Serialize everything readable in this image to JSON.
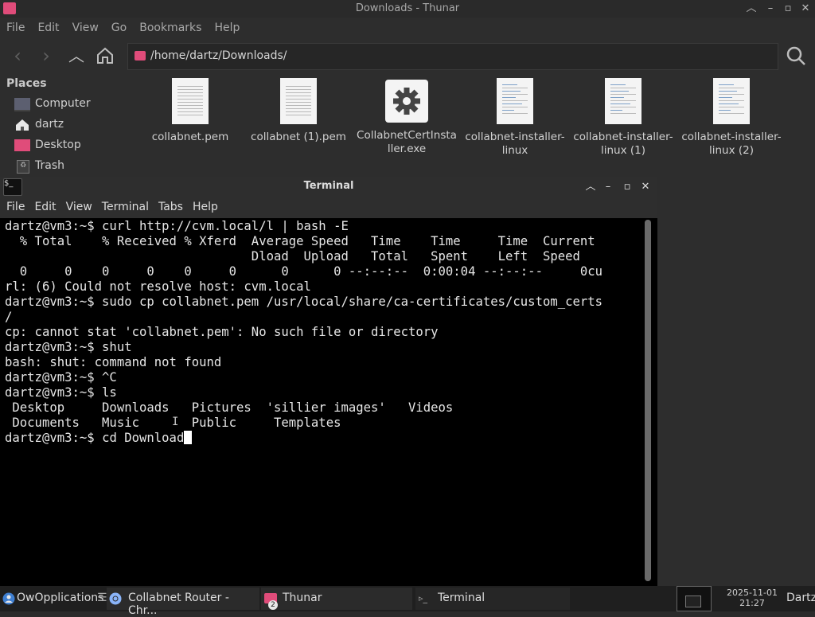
{
  "thunar": {
    "title": "Downloads - Thunar",
    "menu": [
      "File",
      "Edit",
      "View",
      "Go",
      "Bookmarks",
      "Help"
    ],
    "path": "/home/dartz/Downloads/",
    "places_header": "Places",
    "places": [
      "Computer",
      "dartz",
      "Desktop",
      "Trash"
    ],
    "files": [
      {
        "name": "collabnet.pem",
        "icon": "text-document-icon"
      },
      {
        "name": "collabnet (1).pem",
        "icon": "text-document-icon"
      },
      {
        "name": "CollabnetCertInstaller.exe",
        "icon": "gear-executable-icon"
      },
      {
        "name": "collabnet-installer-linux",
        "icon": "script-document-icon"
      },
      {
        "name": "collabnet-installer-linux (1)",
        "icon": "script-document-icon"
      },
      {
        "name": "collabnet-installer-linux (2)",
        "icon": "script-document-icon"
      }
    ]
  },
  "terminal": {
    "title": "Terminal",
    "menu": [
      "File",
      "Edit",
      "View",
      "Terminal",
      "Tabs",
      "Help"
    ],
    "lines": [
      "dartz@vm3:~$ curl http://cvm.local/l | bash -E",
      "  % Total    % Received % Xferd  Average Speed   Time    Time     Time  Current",
      "                                 Dload  Upload   Total   Spent    Left  Speed",
      "  0     0    0     0    0     0      0      0 --:--:--  0:00:04 --:--:--     0cu",
      "rl: (6) Could not resolve host: cvm.local",
      "dartz@vm3:~$ sudo cp collabnet.pem /usr/local/share/ca-certificates/custom_certs",
      "/",
      "cp: cannot stat 'collabnet.pem': No such file or directory",
      "dartz@vm3:~$ shut",
      "bash: shut: command not found",
      "dartz@vm3:~$ ^C",
      "dartz@vm3:~$ ls",
      " Desktop     Downloads   Pictures  'sillier images'   Videos",
      " Documents   Music       Public     Templates"
    ],
    "prompt": "dartz@vm3:~$ ",
    "current_input": "cd Download"
  },
  "taskbar": {
    "start_label": "OwOpplications",
    "tasks": [
      "Collabnet Router - Chr...",
      "Thunar",
      "Terminal"
    ],
    "thunar_badge": "2",
    "date": "2025-11-01",
    "time": "21:27",
    "user": "Dartz"
  },
  "colors": {
    "accent_pink": "#e04c7a",
    "terminal_bg": "#000000",
    "window_bg": "#2d2d2d"
  }
}
